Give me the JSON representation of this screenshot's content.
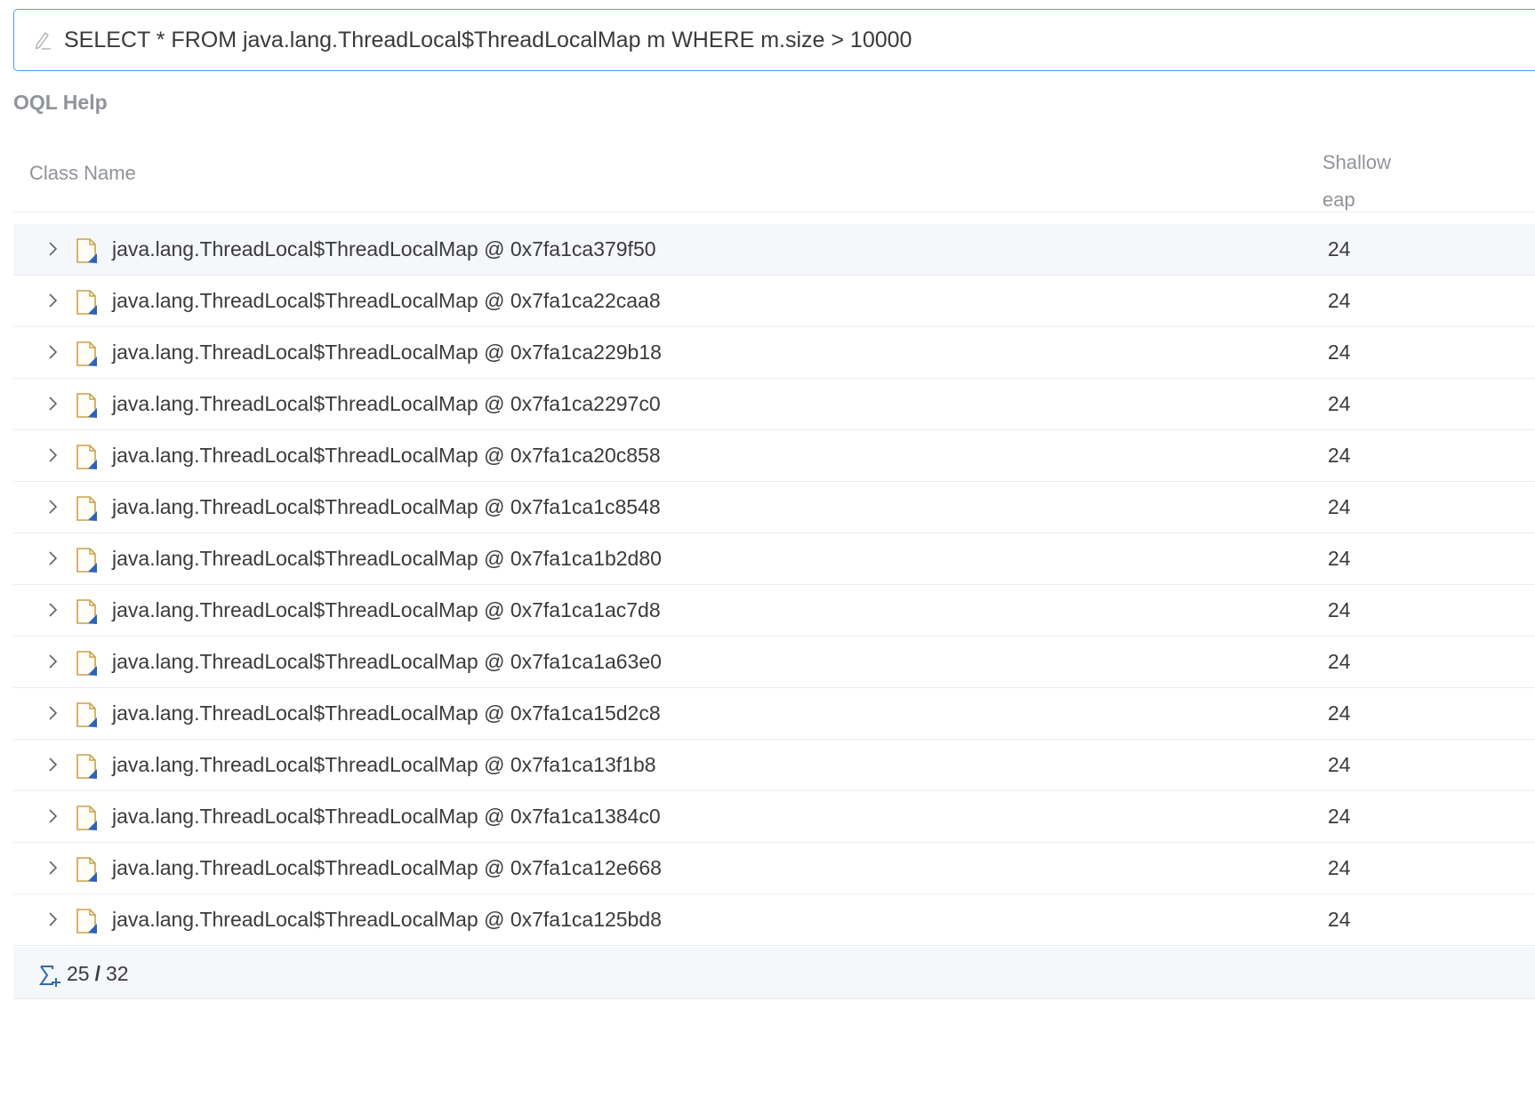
{
  "query": {
    "text": "SELECT * FROM java.lang.ThreadLocal$ThreadLocalMap m WHERE m.size > 10000",
    "icon": "edit-icon"
  },
  "help": {
    "label": "OQL Help"
  },
  "table": {
    "columns": {
      "class_name": "Class Name",
      "shallow_line1": "Shallow",
      "shallow_line2": "eap"
    },
    "rows": [
      {
        "label": "java.lang.ThreadLocal$ThreadLocalMap @ 0x7fa1ca379f50",
        "shallow": "24"
      },
      {
        "label": "java.lang.ThreadLocal$ThreadLocalMap @ 0x7fa1ca22caa8",
        "shallow": "24"
      },
      {
        "label": "java.lang.ThreadLocal$ThreadLocalMap @ 0x7fa1ca229b18",
        "shallow": "24"
      },
      {
        "label": "java.lang.ThreadLocal$ThreadLocalMap @ 0x7fa1ca2297c0",
        "shallow": "24"
      },
      {
        "label": "java.lang.ThreadLocal$ThreadLocalMap @ 0x7fa1ca20c858",
        "shallow": "24"
      },
      {
        "label": "java.lang.ThreadLocal$ThreadLocalMap @ 0x7fa1ca1c8548",
        "shallow": "24"
      },
      {
        "label": "java.lang.ThreadLocal$ThreadLocalMap @ 0x7fa1ca1b2d80",
        "shallow": "24"
      },
      {
        "label": "java.lang.ThreadLocal$ThreadLocalMap @ 0x7fa1ca1ac7d8",
        "shallow": "24"
      },
      {
        "label": "java.lang.ThreadLocal$ThreadLocalMap @ 0x7fa1ca1a63e0",
        "shallow": "24"
      },
      {
        "label": "java.lang.ThreadLocal$ThreadLocalMap @ 0x7fa1ca15d2c8",
        "shallow": "24"
      },
      {
        "label": "java.lang.ThreadLocal$ThreadLocalMap @ 0x7fa1ca13f1b8",
        "shallow": "24"
      },
      {
        "label": "java.lang.ThreadLocal$ThreadLocalMap @ 0x7fa1ca1384c0",
        "shallow": "24"
      },
      {
        "label": "java.lang.ThreadLocal$ThreadLocalMap @ 0x7fa1ca12e668",
        "shallow": "24"
      },
      {
        "label": "java.lang.ThreadLocal$ThreadLocalMap @ 0x7fa1ca125bd8",
        "shallow": "24"
      }
    ]
  },
  "summary": {
    "shown": "25",
    "separator": "/",
    "total": "32",
    "icon": "sigma-plus-icon"
  },
  "colors": {
    "accent": "#409eff",
    "muted_text": "#909399",
    "row_border": "#ebeef5",
    "row_highlight": "#f5f7fa"
  }
}
